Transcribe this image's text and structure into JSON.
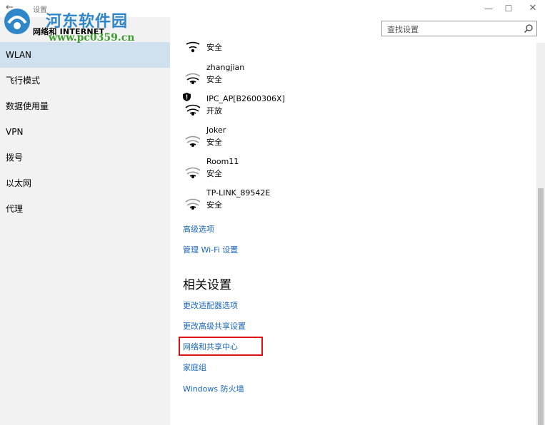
{
  "window": {
    "app_title": "设置",
    "section_title": "网络和 INTERNET",
    "back_icon": "←",
    "minimize_icon": "—",
    "maximize_icon": "☐",
    "close_icon": "✕"
  },
  "watermark": {
    "title": "河东软件园",
    "url": "www.pc0359.cn"
  },
  "search": {
    "placeholder": "查找设置"
  },
  "sidebar": {
    "items": [
      {
        "label": "WLAN",
        "active": true
      },
      {
        "label": "飞行模式"
      },
      {
        "label": "数据使用量"
      },
      {
        "label": "VPN"
      },
      {
        "label": "拨号"
      },
      {
        "label": "以太网"
      },
      {
        "label": "代理"
      }
    ]
  },
  "networks": [
    {
      "name": "",
      "status": "安全",
      "secured": true
    },
    {
      "name": "zhangjian",
      "status": "安全",
      "secured": true
    },
    {
      "name": "IPC_AP[B2600306X]",
      "status": "开放",
      "secured": false
    },
    {
      "name": "Joker",
      "status": "安全",
      "secured": true
    },
    {
      "name": "Room11",
      "status": "安全",
      "secured": true
    },
    {
      "name": "TP-LINK_89542E",
      "status": "安全",
      "secured": true
    }
  ],
  "links": {
    "advanced": "高级选项",
    "manage_wifi": "管理 Wi-Fi 设置"
  },
  "related": {
    "heading": "相关设置",
    "adapter": "更改适配器选项",
    "sharing": "更改高级共享设置",
    "network_center": "网络和共享中心",
    "homegroup": "家庭组",
    "firewall": "Windows 防火墙"
  },
  "colors": {
    "accent": "#1a66b8",
    "sidebar_bg": "#f2f2f2",
    "active_bg": "#cfe0ef",
    "highlight": "#dd1111"
  }
}
